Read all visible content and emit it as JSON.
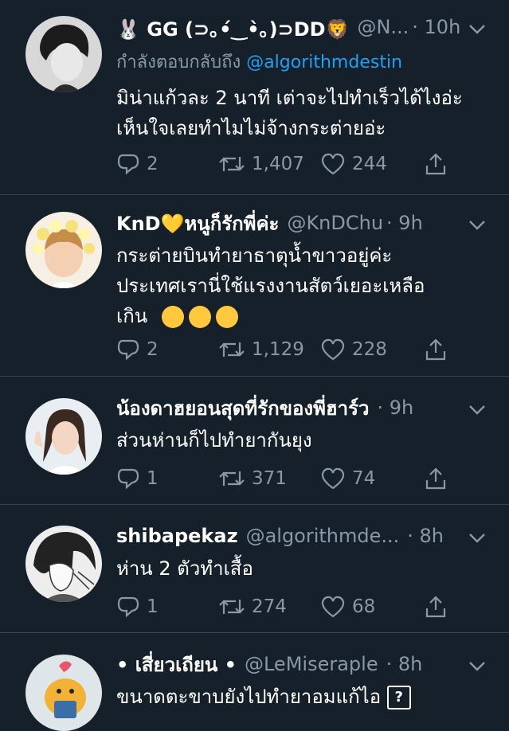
{
  "tweets": [
    {
      "name": "🐰 GG (⊃｡•́‿•̀｡)⊃DD🦁",
      "handle": "@N...",
      "time": "· 10h",
      "reply_prefix": "กำลังตอบกลับถึง ",
      "reply_mention": "@algorithmdestin",
      "text_lines": [
        "มิน่าแก้วละ 2 นาที เต่าจะไปทำเร็วได้ไงอ่ะ",
        "เห็นใจเลยทำไมไม่จ้างกระต่ายอ่ะ"
      ],
      "replies": "2",
      "retweets": "1,407",
      "likes": "244"
    },
    {
      "name": "KnD💛หนูก็รักพี่ค่ะ",
      "handle": "@KnDChu",
      "time": "· 9h",
      "text_lines": [
        "กระต่ายบินทำยาธาตุน้ำขาวอยู่ค่ะ",
        "ประเทศเรานี่ใช้แรงงานสัตว์เยอะเหลือ",
        "เกิน"
      ],
      "emoji": "crying-face",
      "replies": "2",
      "retweets": "1,129",
      "likes": "228"
    },
    {
      "name": "น้องดาฮยอนสุดที่รักของพี่ฮาร์ว",
      "handle": "",
      "time": "· 9h",
      "text_lines": [
        "ส่วนห่านก็ไปทำยากันยุง"
      ],
      "replies": "1",
      "retweets": "371",
      "likes": "74"
    },
    {
      "name": "shibapekaz",
      "handle": "@algorithmde...",
      "time": "· 8h",
      "text_lines": [
        "ห่าน 2 ตัวทำเสื้อ"
      ],
      "replies": "1",
      "retweets": "274",
      "likes": "68"
    },
    {
      "name": "• เสี่ยวเถียน •",
      "handle": "@LeMiseraple",
      "time": "· 8h",
      "text_lines": [
        "ขนาดตะขาบยังไปทำยาอมแก้ไอ"
      ],
      "trailing_symbol": "?",
      "replies": "",
      "retweets": "",
      "likes": ""
    }
  ],
  "colors": {
    "background": "#15202b",
    "muted": "#8899a6",
    "link": "#1da1f2",
    "divider": "#38444d"
  }
}
